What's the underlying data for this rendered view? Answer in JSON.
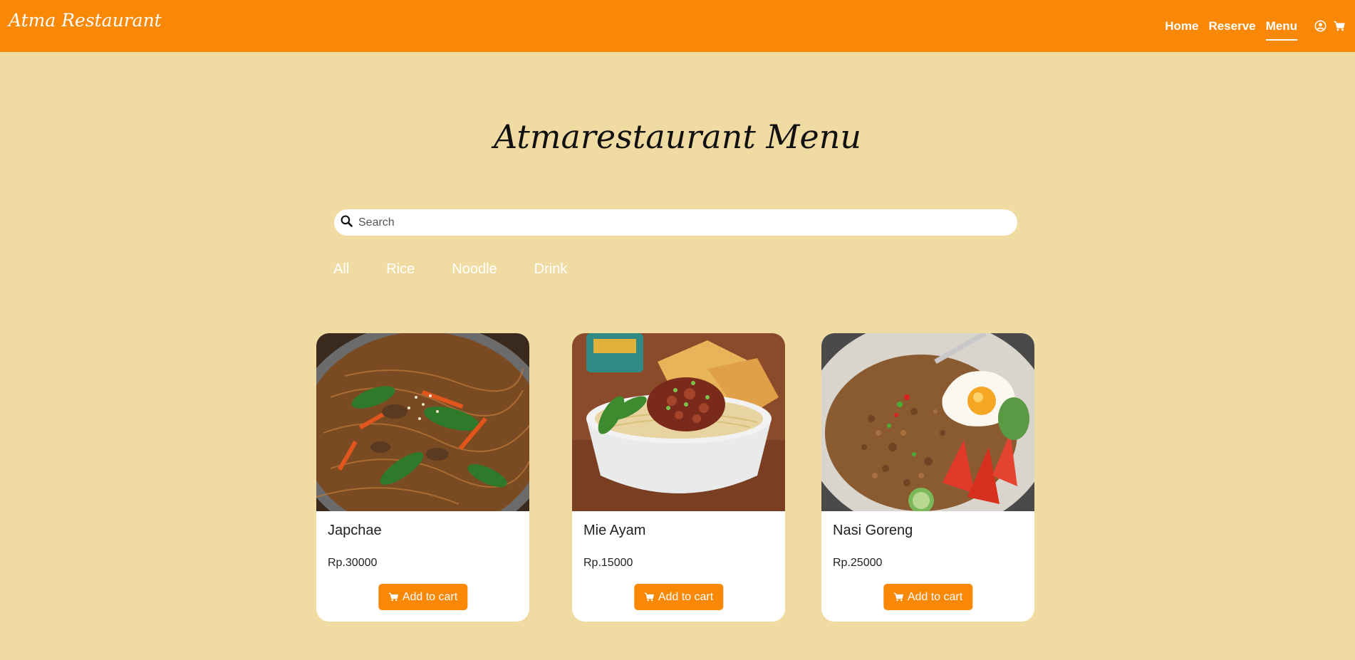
{
  "nav": {
    "brand": "Atma Restaurant",
    "links": [
      "Home",
      "Reserve",
      "Menu"
    ],
    "active": "Menu",
    "icons": [
      "user-circle-icon",
      "cart-icon"
    ]
  },
  "page": {
    "title": "Atmarestaurant Menu"
  },
  "search": {
    "placeholder": "Search",
    "value": ""
  },
  "filters": [
    "All",
    "Rice",
    "Noodle",
    "Drink"
  ],
  "products": [
    {
      "name": "Japchae",
      "price": "Rp.30000",
      "button": "Add to cart",
      "image": "japchae-noodle-photo"
    },
    {
      "name": "Mie Ayam",
      "price": "Rp.15000",
      "button": "Add to cart",
      "image": "mie-ayam-bowl-photo"
    },
    {
      "name": "Nasi Goreng",
      "price": "Rp.25000",
      "button": "Add to cart",
      "image": "nasi-goreng-plate-photo"
    }
  ],
  "colors": {
    "nav": "#f88806",
    "background": "#f0dba3",
    "button": "#f88806",
    "card": "#ffffff"
  }
}
